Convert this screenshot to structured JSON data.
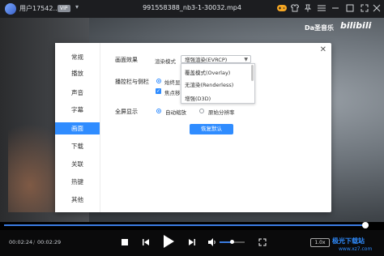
{
  "titlebar": {
    "user_name": "用户17542...",
    "vip_badge": "VIP",
    "file_title": "991558388_nb3-1-30032.mp4"
  },
  "video": {
    "watermark_text": "Da圣音乐",
    "logo_text": "bilibili"
  },
  "settings_dialog": {
    "sidebar": [
      {
        "label": "常规"
      },
      {
        "label": "播放"
      },
      {
        "label": "声音"
      },
      {
        "label": "字幕"
      },
      {
        "label": "画面"
      },
      {
        "label": "下载"
      },
      {
        "label": "关联"
      },
      {
        "label": "热键"
      },
      {
        "label": "其他"
      }
    ],
    "active_index": 4,
    "picture_effect": {
      "section_label": "画面效果",
      "mode_label": "渲染模式",
      "selected_value": "增强渲染(EVRCP)",
      "dropdown_options": [
        "覆盖模式(Overlay)",
        "无渲染(Renderless)",
        "增强(D3D)"
      ]
    },
    "playbar": {
      "section_label": "播控栏与侧栏",
      "option1_text": "始终显",
      "option2_text": "焦点移"
    },
    "fullscreen": {
      "section_label": "全屏显示",
      "option_auto": "自动缩放",
      "option_original": "原始分辨率"
    },
    "restore_button": "恢复默认"
  },
  "player": {
    "time_current": "00:02:24",
    "time_total": "00:02:29",
    "progress": 0.99,
    "volume": 0.5,
    "speed_label": "1.0x"
  },
  "site_watermark": {
    "line1": "极光下载站",
    "line2": "www.xz7.com"
  },
  "colors": {
    "accent": "#2f8cff",
    "titlebar_bg": "#1c1d20",
    "controls_bg": "#0a0a0b"
  }
}
